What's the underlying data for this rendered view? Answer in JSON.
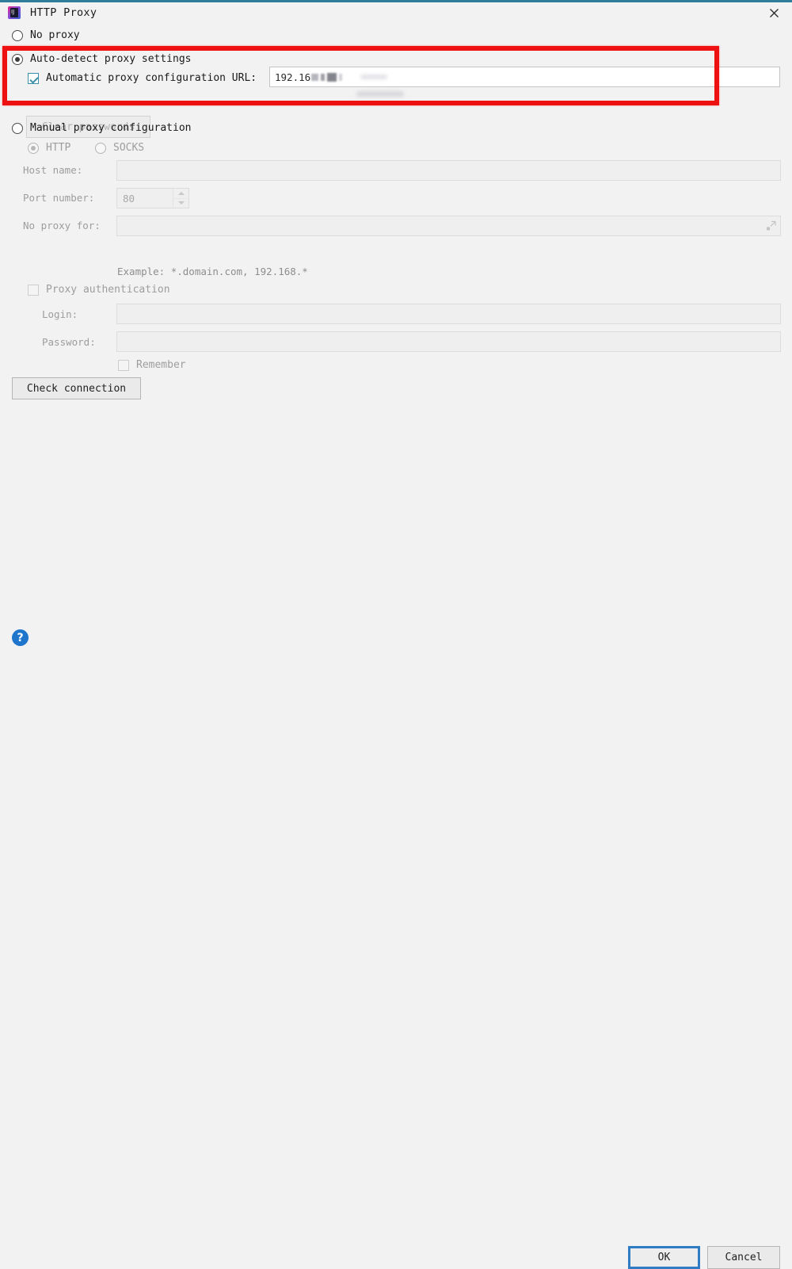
{
  "window": {
    "title": "HTTP Proxy",
    "app_icon": "intellij-idea-icon",
    "close_icon": "close-icon",
    "accent_color": "#2e7d9a",
    "background_color": "#f2f2f2"
  },
  "options": {
    "no_proxy": {
      "label": "No proxy",
      "selected": false
    },
    "auto_detect": {
      "label": "Auto-detect proxy settings",
      "selected": true
    },
    "manual": {
      "label": "Manual proxy configuration",
      "selected": false
    }
  },
  "auto_detect": {
    "pac_checkbox_label": "Automatic proxy configuration URL:",
    "pac_checked": true,
    "pac_url_value": "192.16",
    "pac_url_redacted": true,
    "clear_passwords_label": "Clear passwords",
    "clear_passwords_enabled": false
  },
  "manual": {
    "protocol_http_label": "HTTP",
    "protocol_socks_label": "SOCKS",
    "protocol_selected": "HTTP",
    "host_name_label": "Host name:",
    "host_name_value": "",
    "port_number_label": "Port number:",
    "port_number_value": "80",
    "no_proxy_for_label": "No proxy for:",
    "no_proxy_for_value": "",
    "no_proxy_for_expand_icon": "expand-icon",
    "example_hint": "Example: *.domain.com, 192.168.*",
    "proxy_auth_label": "Proxy authentication",
    "proxy_auth_checked": false,
    "login_label": "Login:",
    "login_value": "",
    "password_label": "Password:",
    "password_value": "",
    "remember_label": "Remember",
    "remember_checked": false,
    "check_connection_label": "Check connection"
  },
  "highlight": {
    "color": "#ee1111",
    "note": "red annotation rectangle around auto-detect proxy settings"
  },
  "footer": {
    "help_icon": "help-icon",
    "help_glyph": "?",
    "ok_label": "OK",
    "cancel_label": "Cancel",
    "ok_focused": true,
    "focus_color": "#2f7cc4"
  }
}
